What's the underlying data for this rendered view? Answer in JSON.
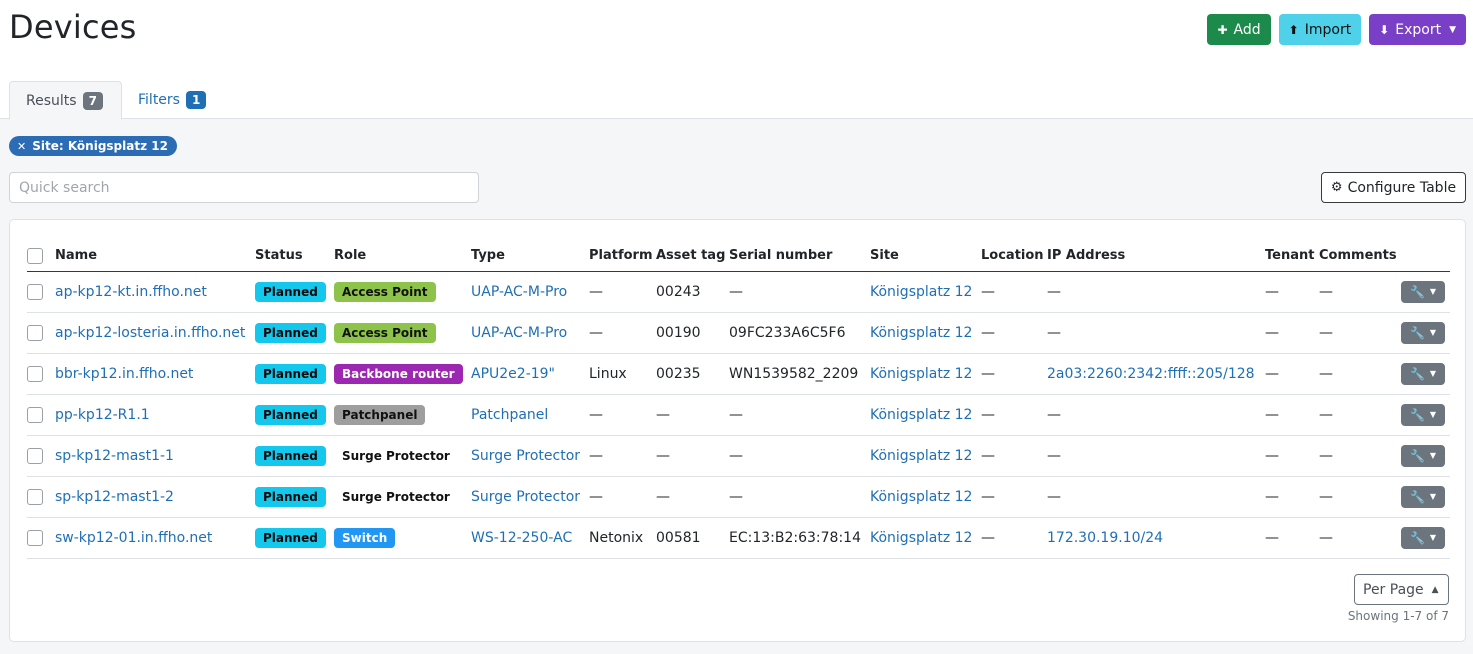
{
  "page": {
    "title": "Devices",
    "buttons": {
      "add": "Add",
      "import": "Import",
      "export": "Export"
    }
  },
  "tabs": {
    "results_label": "Results",
    "results_count": "7",
    "filters_label": "Filters",
    "filters_count": "1"
  },
  "filter_chip": "Site: Königsplatz 12",
  "search": {
    "placeholder": "Quick search",
    "value": ""
  },
  "configure_label": "Configure Table",
  "table": {
    "columns": [
      "Name",
      "Status",
      "Role",
      "Type",
      "Platform",
      "Asset tag",
      "Serial number",
      "Site",
      "Location",
      "IP Address",
      "Tenant",
      "Comments"
    ],
    "rows": [
      {
        "name": "ap-kp12-kt.in.ffho.net",
        "status": "Planned",
        "role": "Access Point",
        "role_class": "role-access",
        "type": "UAP-AC-M-Pro",
        "platform": "—",
        "asset_tag": "00243",
        "serial": "—",
        "site": "Königsplatz 12",
        "location": "—",
        "ip": "—",
        "tenant": "—",
        "comments": "—"
      },
      {
        "name": "ap-kp12-losteria.in.ffho.net",
        "status": "Planned",
        "role": "Access Point",
        "role_class": "role-access",
        "type": "UAP-AC-M-Pro",
        "platform": "—",
        "asset_tag": "00190",
        "serial": "09FC233A6C5F6",
        "site": "Königsplatz 12",
        "location": "—",
        "ip": "—",
        "tenant": "—",
        "comments": "—"
      },
      {
        "name": "bbr-kp12.in.ffho.net",
        "status": "Planned",
        "role": "Backbone router",
        "role_class": "role-backbone",
        "type": "APU2e2-19\"",
        "platform": "Linux",
        "asset_tag": "00235",
        "serial": "WN1539582_2209",
        "site": "Königsplatz 12",
        "location": "—",
        "ip": "2a03:2260:2342:ffff::205/128",
        "tenant": "—",
        "comments": "—"
      },
      {
        "name": "pp-kp12-R1.1",
        "status": "Planned",
        "role": "Patchpanel",
        "role_class": "role-patch",
        "type": "Patchpanel",
        "platform": "—",
        "asset_tag": "—",
        "serial": "—",
        "site": "Königsplatz 12",
        "location": "—",
        "ip": "—",
        "tenant": "—",
        "comments": "—"
      },
      {
        "name": "sp-kp12-mast1-1",
        "status": "Planned",
        "role": "Surge Protector",
        "role_class": "role-surge",
        "type": "Surge Protector",
        "platform": "—",
        "asset_tag": "—",
        "serial": "—",
        "site": "Königsplatz 12",
        "location": "—",
        "ip": "—",
        "tenant": "—",
        "comments": "—"
      },
      {
        "name": "sp-kp12-mast1-2",
        "status": "Planned",
        "role": "Surge Protector",
        "role_class": "role-surge",
        "type": "Surge Protector",
        "platform": "—",
        "asset_tag": "—",
        "serial": "—",
        "site": "Königsplatz 12",
        "location": "—",
        "ip": "—",
        "tenant": "—",
        "comments": "—"
      },
      {
        "name": "sw-kp12-01.in.ffho.net",
        "status": "Planned",
        "role": "Switch",
        "role_class": "role-switch",
        "type": "WS-12-250-AC",
        "platform": "Netonix",
        "asset_tag": "00581",
        "serial": "EC:13:B2:63:78:14",
        "site": "Königsplatz 12",
        "location": "—",
        "ip": "172.30.19.10/24",
        "tenant": "—",
        "comments": "—"
      }
    ]
  },
  "pagination": {
    "per_page_label": "Per Page",
    "showing": "Showing 1-7 of 7"
  },
  "colors": {
    "add": "#1b8a4a",
    "import": "#4fd1ea",
    "export": "#7a3fc7",
    "link": "#1f6fb5",
    "status_planned": "#14c7ec"
  },
  "icons": {
    "add": "plus-icon",
    "import": "upload-icon",
    "export": "download-icon",
    "configure": "gear-icon",
    "row_action": "wrench-icon"
  }
}
